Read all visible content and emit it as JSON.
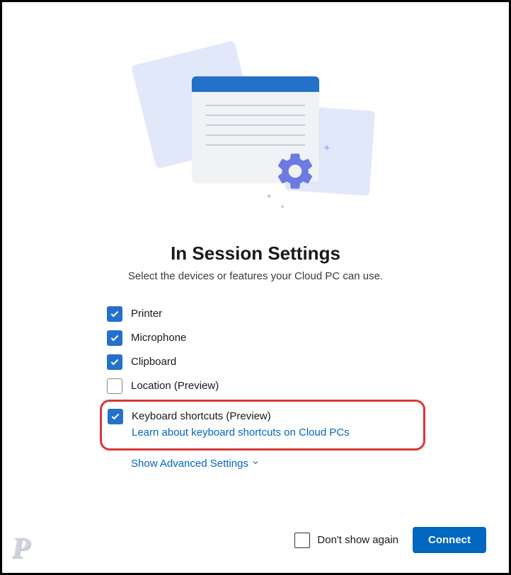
{
  "title": "In Session Settings",
  "subtitle": "Select the devices or features your Cloud PC can use.",
  "options": [
    {
      "label": "Printer",
      "checked": true
    },
    {
      "label": "Microphone",
      "checked": true
    },
    {
      "label": "Clipboard",
      "checked": true
    },
    {
      "label": "Location (Preview)",
      "checked": false
    },
    {
      "label": "Keyboard shortcuts (Preview)",
      "checked": true,
      "link": "Learn about keyboard shortcuts on Cloud PCs",
      "highlighted": true
    }
  ],
  "advanced_link": "Show Advanced Settings",
  "footer": {
    "dont_show_label": "Don't show again",
    "dont_show_checked": false,
    "connect_label": "Connect"
  },
  "watermark": "P"
}
